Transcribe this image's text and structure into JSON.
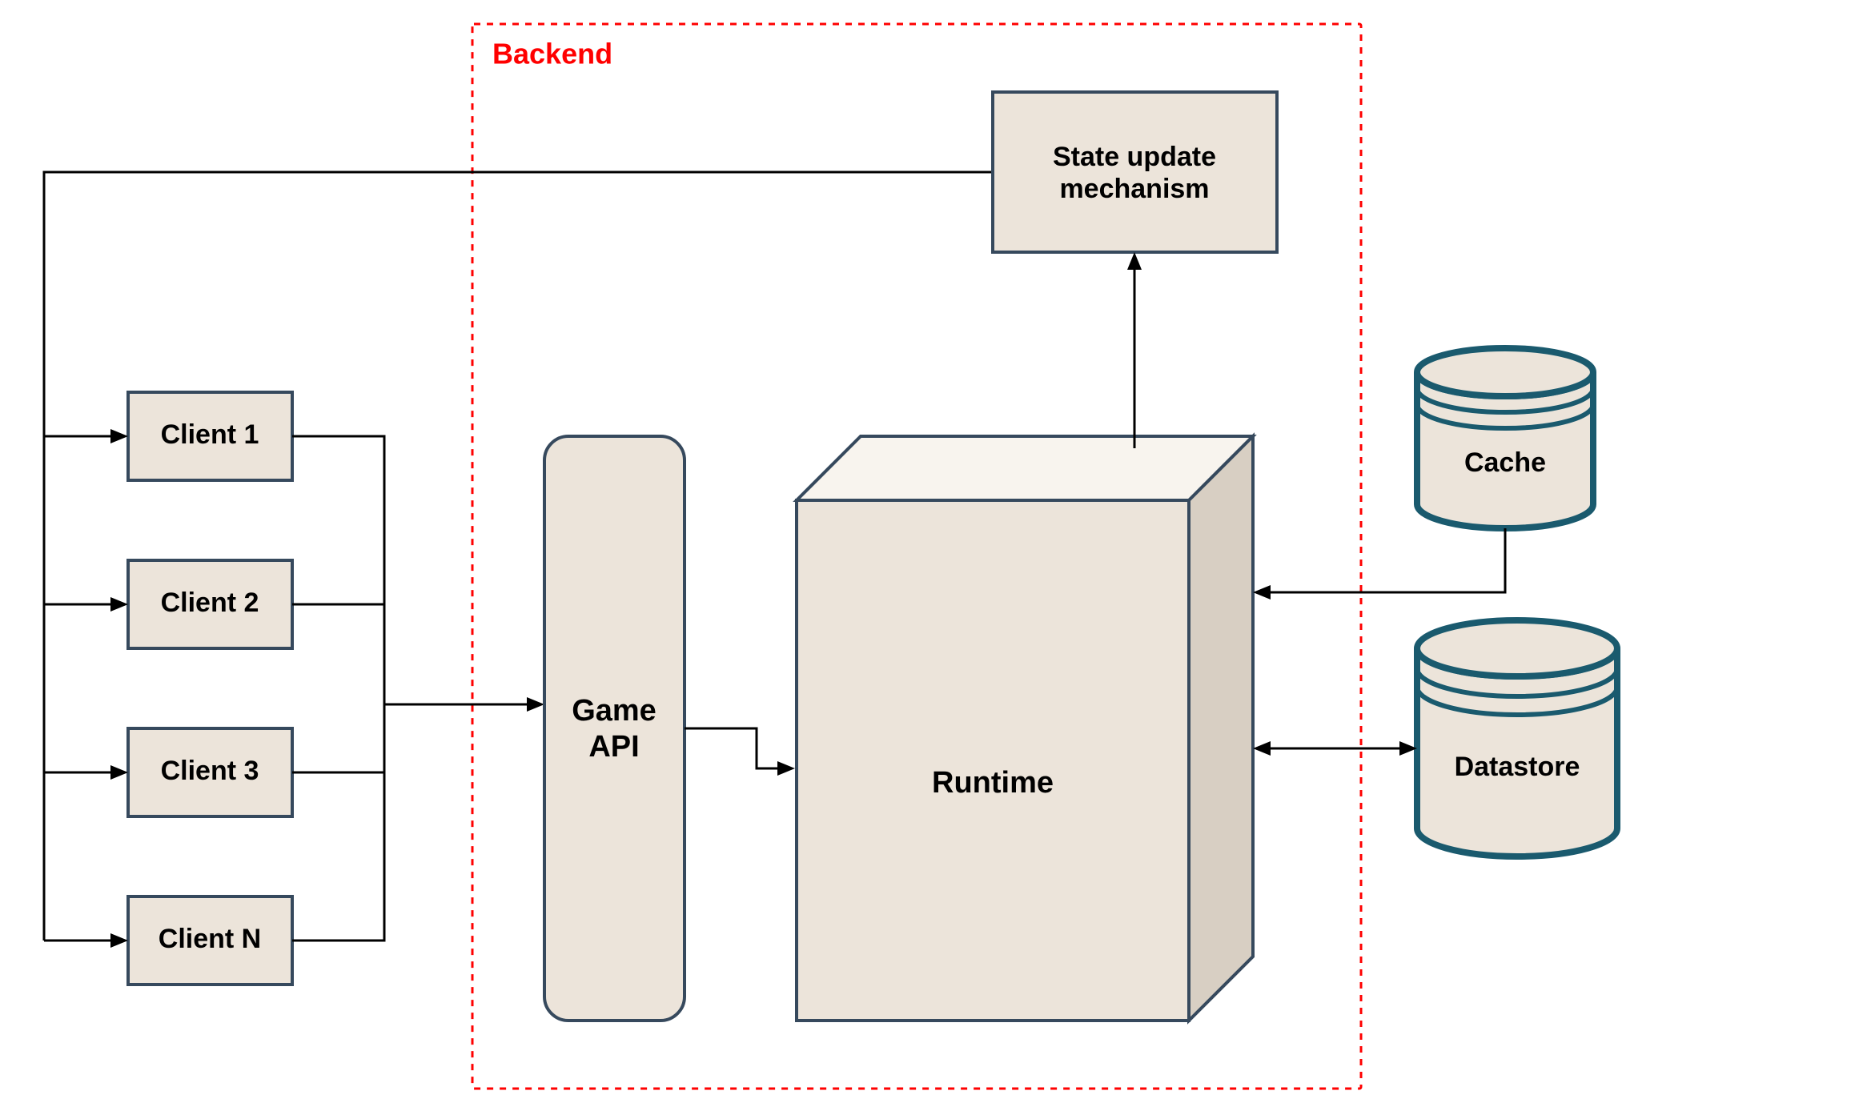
{
  "backend_label": "Backend",
  "clients": {
    "c1": "Client 1",
    "c2": "Client 2",
    "c3": "Client 3",
    "cn": "Client N"
  },
  "game_api": {
    "line1": "Game",
    "line2": "API"
  },
  "runtime": "Runtime",
  "state_update": {
    "line1": "State update",
    "line2": "mechanism"
  },
  "cache": "Cache",
  "datastore": "Datastore"
}
